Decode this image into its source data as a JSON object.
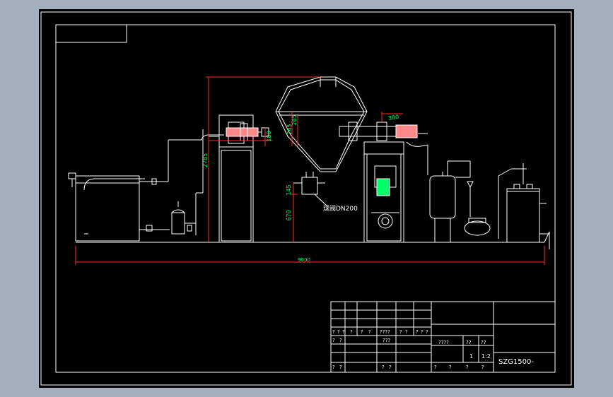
{
  "colors": {
    "background": "#a3afbd",
    "canvas": "#000000",
    "line": "#ffffff",
    "dimension": "#ff2a2a",
    "dimension_text": "#00ff66",
    "equipment_fill": "#ff8a8a"
  },
  "dimensions": {
    "overall_length": "9000",
    "overall_height": "2785",
    "shaft_a": "180",
    "shaft_b": "265",
    "shaft_c": "285",
    "top_offset": "380",
    "outlet_a": "145",
    "outlet_b": "670"
  },
  "annotations": {
    "discharge_valve": "球阀DN200"
  },
  "title_block": {
    "left_table": {
      "row5": [
        "?",
        "?",
        "?",
        "?",
        "?",
        "?",
        "????",
        "?",
        "?",
        "?",
        "?",
        "?"
      ],
      "row6": [
        "?",
        "?",
        "???"
      ],
      "row8": [
        "?",
        "?",
        "?",
        "?"
      ]
    },
    "center": {
      "labels": [
        "????",
        "??",
        "??"
      ],
      "values": [
        "1",
        "1:2"
      ],
      "bottom": [
        "?",
        "?",
        "?",
        "?"
      ]
    },
    "drawing_number": "SZG1500-"
  }
}
